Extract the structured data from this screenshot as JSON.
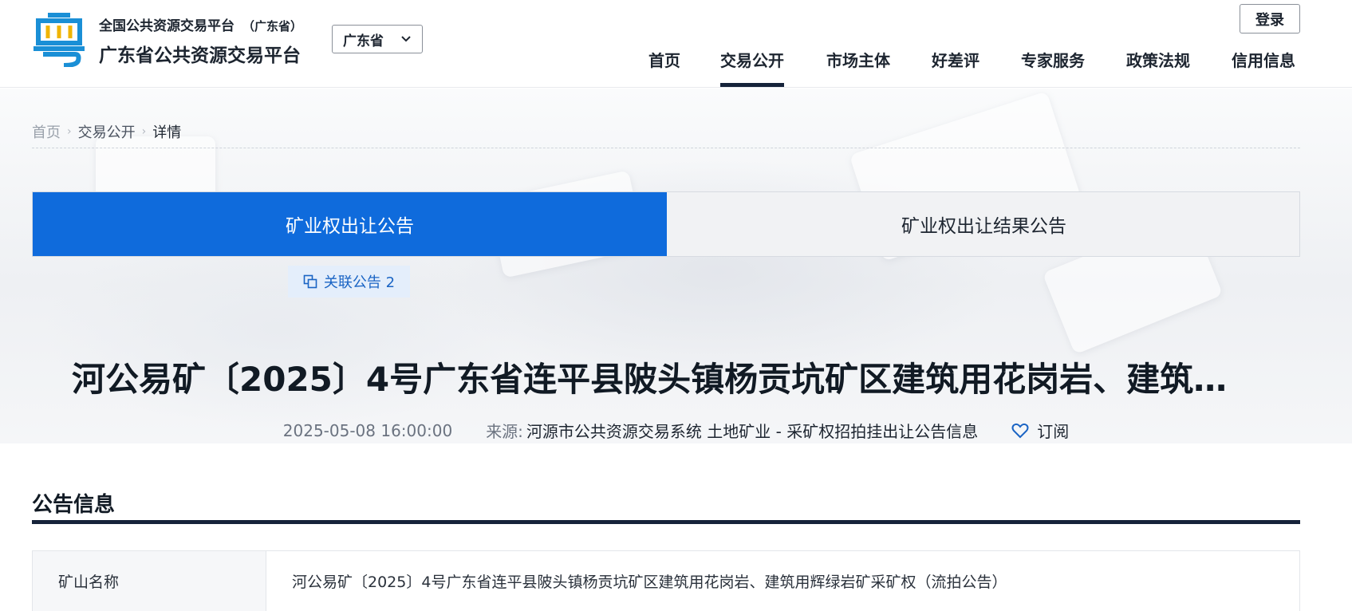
{
  "header": {
    "brand_line1": "全国公共资源交易平台",
    "brand_line1_province": "（广东省）",
    "brand_line2": "广东省公共资源交易平台",
    "region_selected": "广东省",
    "login_label": "登录",
    "nav": [
      {
        "label": "首页"
      },
      {
        "label": "交易公开",
        "active": true
      },
      {
        "label": "市场主体"
      },
      {
        "label": "好差评"
      },
      {
        "label": "专家服务"
      },
      {
        "label": "政策法规"
      },
      {
        "label": "信用信息"
      }
    ]
  },
  "breadcrumb": [
    "首页",
    "交易公开",
    "详情"
  ],
  "tabs": [
    {
      "label": "矿业权出让公告",
      "active": true
    },
    {
      "label": "矿业权出让结果公告",
      "active": false
    }
  ],
  "related": {
    "label": "关联公告",
    "count": "2"
  },
  "notice": {
    "title": "河公易矿〔2025〕4号广东省连平县陂头镇杨贡坑矿区建筑用花岗岩、建筑用辉绿岩矿采矿权（流拍公告）",
    "date": "2025-05-08 16:00:00",
    "source_label": "来源:",
    "source_value": "河源市公共资源交易系统 土地矿业 - 采矿权招拍挂出让公告信息",
    "subscribe_label": "订阅"
  },
  "section": {
    "title": "公告信息",
    "rows": [
      {
        "key": "矿山名称",
        "value": "河公易矿〔2025〕4号广东省连平县陂头镇杨贡坑矿区建筑用花岗岩、建筑用辉绿岩矿采矿权（流拍公告）"
      }
    ]
  },
  "colors": {
    "accent_blue": "#0f6bdc",
    "navy": "#16233a",
    "logo_blue": "#1a8fd6"
  },
  "icons": [
    "logo-emblem",
    "chevron-down-icon",
    "chevron-right-icon",
    "link-copy-icon",
    "heart-icon"
  ]
}
